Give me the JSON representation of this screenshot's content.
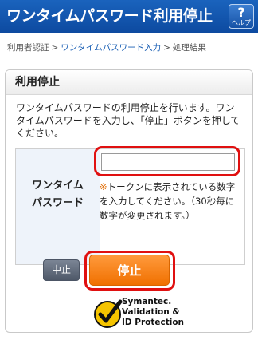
{
  "header": {
    "title": "ワンタイムパスワード利用停止",
    "help_symbol": "?",
    "help_label": "ヘルプ"
  },
  "breadcrumb": {
    "step1": "利用者認証",
    "step2": "ワンタイムパスワード入力",
    "step3": "処理結果",
    "separator": ">"
  },
  "panel": {
    "title": "利用停止",
    "description": "ワンタイムパスワードの利用停止を行います。ワンタイムパスワードを入力し、「停止」ボタンを押してください。"
  },
  "form": {
    "field_label_line1": "ワンタイム",
    "field_label_line2": "パスワード",
    "input_value": "",
    "note_mark": "※",
    "note_text": "トークンに表示されている数字を入力してください。（30秒毎に数字が変更されます。）"
  },
  "buttons": {
    "cancel": "中止",
    "stop": "停止"
  },
  "logo": {
    "line1": "Symantec.",
    "line2": "Validation &",
    "line3": "ID Protection"
  },
  "colors": {
    "header_bg": "#0d4aa0",
    "highlight_ring": "#e01010",
    "stop_button": "#f07000",
    "link": "#1a5fb4"
  }
}
